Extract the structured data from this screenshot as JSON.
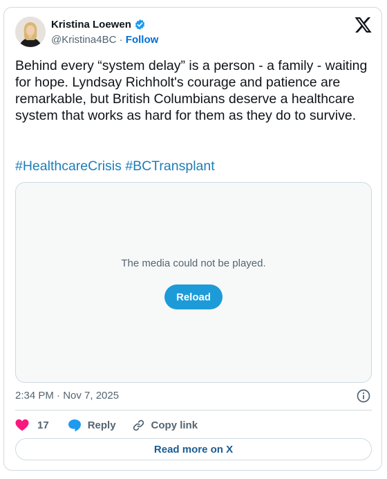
{
  "author": {
    "name": "Kristina Loewen",
    "handle": "@Kristina4BC",
    "separator": "·",
    "follow_label": "Follow",
    "verified_color": "#1d9bf0"
  },
  "post": {
    "text": "Behind every “system delay” is a person -  a family - waiting for hope. Lyndsay Richholt's courage and patience are remarkable, but British Columbians deserve a healthcare system that works as hard for them as they do to survive.",
    "hashtags": [
      "#HealthcareCrisis",
      "#BCTransplant"
    ]
  },
  "media": {
    "message": "The media could not be played.",
    "reload_label": "Reload"
  },
  "timestamp": "2:34 PM · Nov 7, 2025",
  "actions": {
    "like_count": "17",
    "reply_label": "Reply",
    "copy_link_label": "Copy link"
  },
  "read_more_label": "Read more on X",
  "colors": {
    "accent": "#1d9bf0",
    "like": "#f91880",
    "hashtag": "#1d7db8"
  },
  "icons": [
    "verified-badge-icon",
    "x-logo-icon",
    "info-icon",
    "heart-icon",
    "reply-icon",
    "link-icon"
  ]
}
